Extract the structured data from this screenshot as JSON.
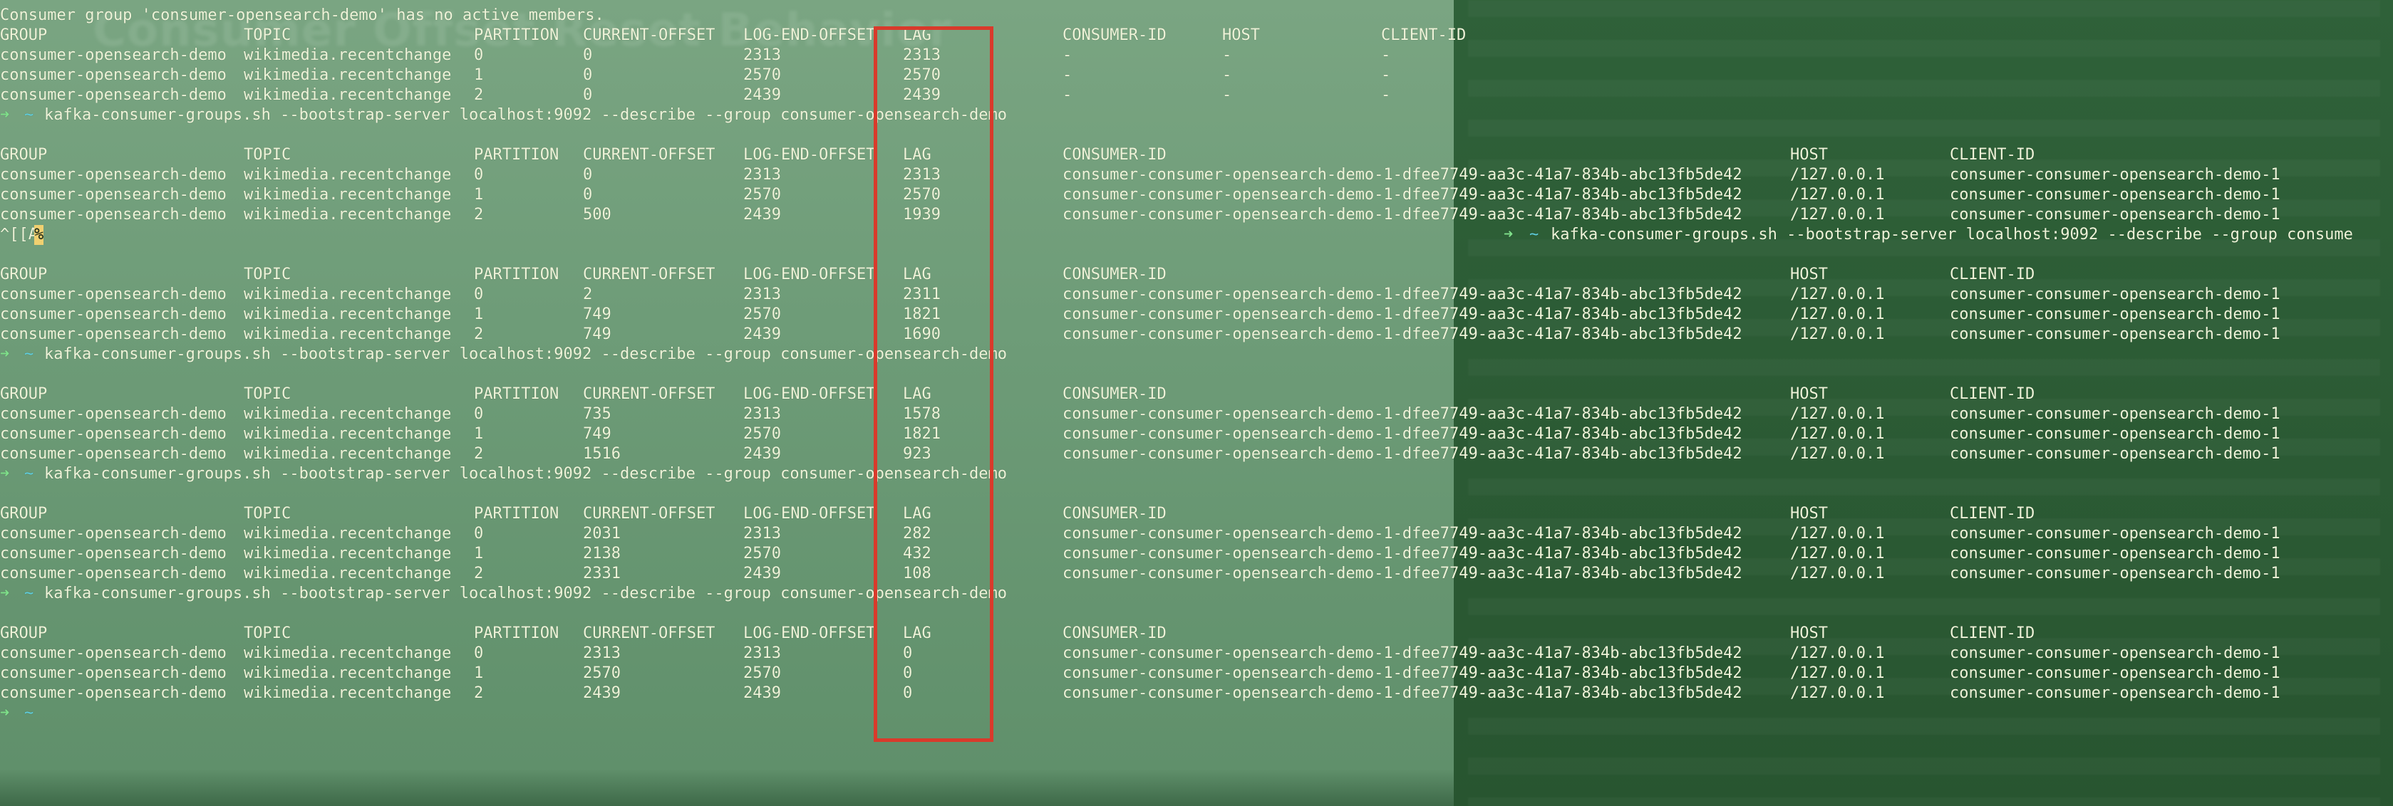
{
  "status_line": "Consumer group 'consumer-opensearch-demo' has no active members.",
  "ghost_title": "Consumer Offset Reset Behavior",
  "command": "kafka-consumer-groups.sh --bootstrap-server localhost:9092 --describe --group consumer-opensearch-demo",
  "command_truncated": "kafka-consumer-groups.sh --bootstrap-server localhost:9092 --describe --group consume",
  "prompt": {
    "arrow": "➜",
    "tilde": "~"
  },
  "stray_input": {
    "prefix": "^[[A",
    "cursor": "%"
  },
  "headers": {
    "group": "GROUP",
    "topic": "TOPIC",
    "partition": "PARTITION",
    "current_offset": "CURRENT-OFFSET",
    "log_end_offset": "LOG-END-OFFSET",
    "lag": "LAG",
    "consumer_id": "CONSUMER-ID",
    "host": "HOST",
    "client_id": "CLIENT-ID"
  },
  "blocks": [
    {
      "rows": [
        {
          "group": "consumer-opensearch-demo",
          "topic": "wikimedia.recentchange",
          "partition": "0",
          "current_offset": "0",
          "log_end_offset": "2313",
          "lag": "2313",
          "consumer_id": "-",
          "host": "-",
          "client_id": "-"
        },
        {
          "group": "consumer-opensearch-demo",
          "topic": "wikimedia.recentchange",
          "partition": "1",
          "current_offset": "0",
          "log_end_offset": "2570",
          "lag": "2570",
          "consumer_id": "-",
          "host": "-",
          "client_id": "-"
        },
        {
          "group": "consumer-opensearch-demo",
          "topic": "wikimedia.recentchange",
          "partition": "2",
          "current_offset": "0",
          "log_end_offset": "2439",
          "lag": "2439",
          "consumer_id": "-",
          "host": "-",
          "client_id": "-"
        }
      ]
    },
    {
      "rows": [
        {
          "group": "consumer-opensearch-demo",
          "topic": "wikimedia.recentchange",
          "partition": "0",
          "current_offset": "0",
          "log_end_offset": "2313",
          "lag": "2313",
          "consumer_id": "consumer-consumer-opensearch-demo-1-dfee7749-aa3c-41a7-834b-abc13fb5de42",
          "host": "/127.0.0.1",
          "client_id": "consumer-consumer-opensearch-demo-1"
        },
        {
          "group": "consumer-opensearch-demo",
          "topic": "wikimedia.recentchange",
          "partition": "1",
          "current_offset": "0",
          "log_end_offset": "2570",
          "lag": "2570",
          "consumer_id": "consumer-consumer-opensearch-demo-1-dfee7749-aa3c-41a7-834b-abc13fb5de42",
          "host": "/127.0.0.1",
          "client_id": "consumer-consumer-opensearch-demo-1"
        },
        {
          "group": "consumer-opensearch-demo",
          "topic": "wikimedia.recentchange",
          "partition": "2",
          "current_offset": "500",
          "log_end_offset": "2439",
          "lag": "1939",
          "consumer_id": "consumer-consumer-opensearch-demo-1-dfee7749-aa3c-41a7-834b-abc13fb5de42",
          "host": "/127.0.0.1",
          "client_id": "consumer-consumer-opensearch-demo-1"
        }
      ]
    },
    {
      "rows": [
        {
          "group": "consumer-opensearch-demo",
          "topic": "wikimedia.recentchange",
          "partition": "0",
          "current_offset": "2",
          "log_end_offset": "2313",
          "lag": "2311",
          "consumer_id": "consumer-consumer-opensearch-demo-1-dfee7749-aa3c-41a7-834b-abc13fb5de42",
          "host": "/127.0.0.1",
          "client_id": "consumer-consumer-opensearch-demo-1"
        },
        {
          "group": "consumer-opensearch-demo",
          "topic": "wikimedia.recentchange",
          "partition": "1",
          "current_offset": "749",
          "log_end_offset": "2570",
          "lag": "1821",
          "consumer_id": "consumer-consumer-opensearch-demo-1-dfee7749-aa3c-41a7-834b-abc13fb5de42",
          "host": "/127.0.0.1",
          "client_id": "consumer-consumer-opensearch-demo-1"
        },
        {
          "group": "consumer-opensearch-demo",
          "topic": "wikimedia.recentchange",
          "partition": "2",
          "current_offset": "749",
          "log_end_offset": "2439",
          "lag": "1690",
          "consumer_id": "consumer-consumer-opensearch-demo-1-dfee7749-aa3c-41a7-834b-abc13fb5de42",
          "host": "/127.0.0.1",
          "client_id": "consumer-consumer-opensearch-demo-1"
        }
      ]
    },
    {
      "rows": [
        {
          "group": "consumer-opensearch-demo",
          "topic": "wikimedia.recentchange",
          "partition": "0",
          "current_offset": "735",
          "log_end_offset": "2313",
          "lag": "1578",
          "consumer_id": "consumer-consumer-opensearch-demo-1-dfee7749-aa3c-41a7-834b-abc13fb5de42",
          "host": "/127.0.0.1",
          "client_id": "consumer-consumer-opensearch-demo-1"
        },
        {
          "group": "consumer-opensearch-demo",
          "topic": "wikimedia.recentchange",
          "partition": "1",
          "current_offset": "749",
          "log_end_offset": "2570",
          "lag": "1821",
          "consumer_id": "consumer-consumer-opensearch-demo-1-dfee7749-aa3c-41a7-834b-abc13fb5de42",
          "host": "/127.0.0.1",
          "client_id": "consumer-consumer-opensearch-demo-1"
        },
        {
          "group": "consumer-opensearch-demo",
          "topic": "wikimedia.recentchange",
          "partition": "2",
          "current_offset": "1516",
          "log_end_offset": "2439",
          "lag": "923",
          "consumer_id": "consumer-consumer-opensearch-demo-1-dfee7749-aa3c-41a7-834b-abc13fb5de42",
          "host": "/127.0.0.1",
          "client_id": "consumer-consumer-opensearch-demo-1"
        }
      ]
    },
    {
      "rows": [
        {
          "group": "consumer-opensearch-demo",
          "topic": "wikimedia.recentchange",
          "partition": "0",
          "current_offset": "2031",
          "log_end_offset": "2313",
          "lag": "282",
          "consumer_id": "consumer-consumer-opensearch-demo-1-dfee7749-aa3c-41a7-834b-abc13fb5de42",
          "host": "/127.0.0.1",
          "client_id": "consumer-consumer-opensearch-demo-1"
        },
        {
          "group": "consumer-opensearch-demo",
          "topic": "wikimedia.recentchange",
          "partition": "1",
          "current_offset": "2138",
          "log_end_offset": "2570",
          "lag": "432",
          "consumer_id": "consumer-consumer-opensearch-demo-1-dfee7749-aa3c-41a7-834b-abc13fb5de42",
          "host": "/127.0.0.1",
          "client_id": "consumer-consumer-opensearch-demo-1"
        },
        {
          "group": "consumer-opensearch-demo",
          "topic": "wikimedia.recentchange",
          "partition": "2",
          "current_offset": "2331",
          "log_end_offset": "2439",
          "lag": "108",
          "consumer_id": "consumer-consumer-opensearch-demo-1-dfee7749-aa3c-41a7-834b-abc13fb5de42",
          "host": "/127.0.0.1",
          "client_id": "consumer-consumer-opensearch-demo-1"
        }
      ]
    },
    {
      "rows": [
        {
          "group": "consumer-opensearch-demo",
          "topic": "wikimedia.recentchange",
          "partition": "0",
          "current_offset": "2313",
          "log_end_offset": "2313",
          "lag": "0",
          "consumer_id": "consumer-consumer-opensearch-demo-1-dfee7749-aa3c-41a7-834b-abc13fb5de42",
          "host": "/127.0.0.1",
          "client_id": "consumer-consumer-opensearch-demo-1"
        },
        {
          "group": "consumer-opensearch-demo",
          "topic": "wikimedia.recentchange",
          "partition": "1",
          "current_offset": "2570",
          "log_end_offset": "2570",
          "lag": "0",
          "consumer_id": "consumer-consumer-opensearch-demo-1-dfee7749-aa3c-41a7-834b-abc13fb5de42",
          "host": "/127.0.0.1",
          "client_id": "consumer-consumer-opensearch-demo-1"
        },
        {
          "group": "consumer-opensearch-demo",
          "topic": "wikimedia.recentchange",
          "partition": "2",
          "current_offset": "2439",
          "log_end_offset": "2439",
          "lag": "0",
          "consumer_id": "consumer-consumer-opensearch-demo-1-dfee7749-aa3c-41a7-834b-abc13fb5de42",
          "host": "/127.0.0.1",
          "client_id": "consumer-consumer-opensearch-demo-1"
        }
      ]
    }
  ],
  "colors": {
    "terminal_text": "#eef3d8",
    "prompt_arrow": "#7fe08a",
    "prompt_tilde": "#5fd0e0",
    "highlight_box": "#d93a2b",
    "cursor": "#f0d070"
  }
}
